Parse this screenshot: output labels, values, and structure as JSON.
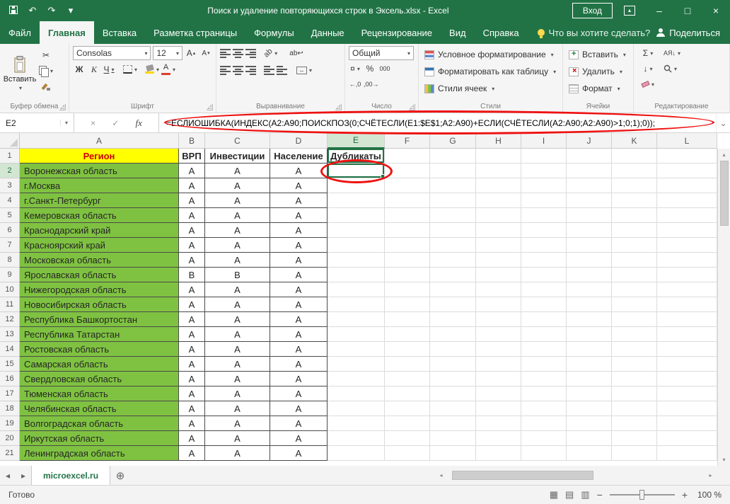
{
  "title_bar": {
    "title": "Поиск и удаление повторяющихся строк в Эксель.xlsx - Excel",
    "sign_in_label": "Вход"
  },
  "ribbon_tabs": {
    "file": "Файл",
    "tabs": [
      "Главная",
      "Вставка",
      "Разметка страницы",
      "Формулы",
      "Данные",
      "Рецензирование",
      "Вид",
      "Справка"
    ],
    "tell_me": "Что вы хотите сделать?",
    "share": "Поделиться"
  },
  "ribbon": {
    "clipboard": {
      "paste": "Вставить",
      "group_label": "Буфер обмена"
    },
    "font": {
      "name": "Consolas",
      "size": "12",
      "bold": "Ж",
      "italic": "К",
      "underline": "Ч",
      "letter": "А",
      "group_label": "Шрифт"
    },
    "alignment": {
      "orientation": "ab",
      "wrap": "ab↩",
      "merge": "↔",
      "group_label": "Выравнивание"
    },
    "number": {
      "format": "Общий",
      "currency": "¤",
      "percent": "%",
      "thousands": "000",
      "dec_increase": "←,0",
      "dec_decrease": ",00→",
      "group_label": "Число"
    },
    "styles": {
      "conditional": "Условное форматирование",
      "format_as_table": "Форматировать как таблицу",
      "cell_styles": "Стили ячеек",
      "group_label": "Стили"
    },
    "cells": {
      "insert": "Вставить",
      "delete": "Удалить",
      "format": "Формат",
      "group_label": "Ячейки"
    },
    "editing": {
      "sum": "Σ",
      "fill": "↓",
      "sort": "АЯ↓",
      "group_label": "Редактирование"
    }
  },
  "formula_bar": {
    "name_box": "E2",
    "cancel": "×",
    "enter": "✓",
    "fx_label": "fx",
    "expand": "⌄",
    "formula": "=ЕСЛИОШИБКА(ИНДЕКС(A2:A90;ПОИСКПОЗ(0;СЧЁТЕСЛИ(E1:$E$1;A2:A90)+ЕСЛИ(СЧЁТЕСЛИ(A2:A90;A2:A90)>1;0;1);0));"
  },
  "grid": {
    "col_letters": [
      "A",
      "B",
      "C",
      "D",
      "E",
      "F",
      "G",
      "H",
      "I",
      "J",
      "K",
      "L"
    ],
    "selected_col": "E",
    "active_cell": "E2",
    "header_row": [
      "Регион",
      "ВРП",
      "Инвестиции",
      "Население",
      "Дубликаты"
    ],
    "rows": [
      [
        "Воронежская область",
        "A",
        "A",
        "A"
      ],
      [
        "г.Москва",
        "A",
        "A",
        "A"
      ],
      [
        "г.Санкт-Петербург",
        "A",
        "A",
        "A"
      ],
      [
        "Кемеровская область",
        "A",
        "A",
        "A"
      ],
      [
        "Краснодарский край",
        "A",
        "A",
        "A"
      ],
      [
        "Красноярский край",
        "A",
        "A",
        "A"
      ],
      [
        "Московская область",
        "A",
        "A",
        "A"
      ],
      [
        "Ярославская область",
        "B",
        "B",
        "A"
      ],
      [
        "Нижегородская область",
        "A",
        "A",
        "A"
      ],
      [
        "Новосибирская область",
        "A",
        "A",
        "A"
      ],
      [
        "Республика Башкортостан",
        "A",
        "A",
        "A"
      ],
      [
        "Республика Татарстан",
        "A",
        "A",
        "A"
      ],
      [
        "Ростовская область",
        "A",
        "A",
        "A"
      ],
      [
        "Самарская область",
        "A",
        "A",
        "A"
      ],
      [
        "Свердловская область",
        "A",
        "A",
        "A"
      ],
      [
        "Тюменская область",
        "A",
        "A",
        "A"
      ],
      [
        "Челябинская область",
        "A",
        "A",
        "A"
      ],
      [
        "Волгоградская область",
        "A",
        "A",
        "A"
      ],
      [
        "Иркутская область",
        "A",
        "A",
        "A"
      ],
      [
        "Ленинградская область",
        "A",
        "A",
        "A"
      ]
    ]
  },
  "sheet_bar": {
    "sheet_name": "microexcel.ru"
  },
  "status_bar": {
    "ready_label": "Готово",
    "zoom_label": "100 %"
  },
  "icons": {
    "undo": "↶",
    "redo": "↷",
    "qat_dropdown": "▾",
    "ribbon_options": "▴",
    "minimize": "–",
    "maximize": "□",
    "close": "×",
    "scissors": "✂",
    "scroll_up": "▴",
    "scroll_down": "▾",
    "scroll_left": "◂",
    "scroll_right": "▸",
    "nav_left": "◂",
    "nav_right": "▸",
    "add_sheet": "⊕",
    "view_normal": "▦",
    "view_layout": "▤",
    "view_break": "▥",
    "zoom_out": "−",
    "zoom_in": "+"
  },
  "colors": {
    "excel_green": "#217346",
    "table_green": "#7fc241",
    "header_yellow": "#ffff00",
    "header_text_red": "#d00000",
    "annotation_red": "#ee1111"
  }
}
